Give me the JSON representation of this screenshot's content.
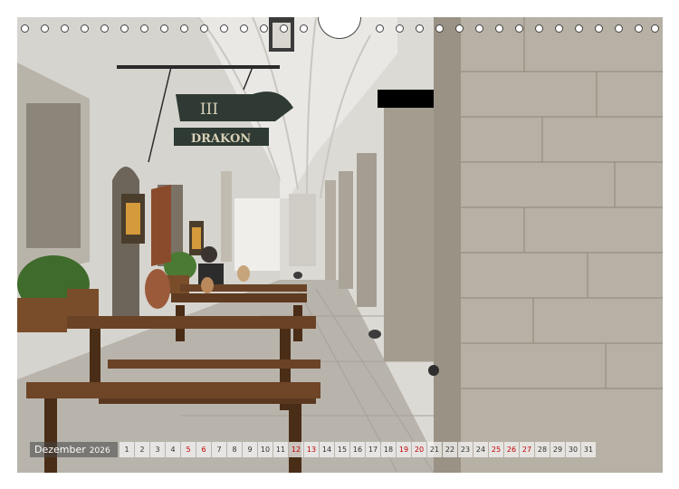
{
  "calendar": {
    "month": "Dezember",
    "year": "2026",
    "days": [
      {
        "n": "1",
        "red": false
      },
      {
        "n": "2",
        "red": false
      },
      {
        "n": "3",
        "red": false
      },
      {
        "n": "4",
        "red": false
      },
      {
        "n": "5",
        "red": true
      },
      {
        "n": "6",
        "red": true
      },
      {
        "n": "7",
        "red": false
      },
      {
        "n": "8",
        "red": false
      },
      {
        "n": "9",
        "red": false
      },
      {
        "n": "10",
        "red": false
      },
      {
        "n": "11",
        "red": false
      },
      {
        "n": "12",
        "red": true
      },
      {
        "n": "13",
        "red": true
      },
      {
        "n": "14",
        "red": false
      },
      {
        "n": "15",
        "red": false
      },
      {
        "n": "16",
        "red": false
      },
      {
        "n": "17",
        "red": false
      },
      {
        "n": "18",
        "red": false
      },
      {
        "n": "19",
        "red": true
      },
      {
        "n": "20",
        "red": true
      },
      {
        "n": "21",
        "red": false
      },
      {
        "n": "22",
        "red": false
      },
      {
        "n": "23",
        "red": false
      },
      {
        "n": "24",
        "red": false
      },
      {
        "n": "25",
        "red": true
      },
      {
        "n": "26",
        "red": true
      },
      {
        "n": "27",
        "red": true
      },
      {
        "n": "28",
        "red": false
      },
      {
        "n": "29",
        "red": false
      },
      {
        "n": "30",
        "red": false
      },
      {
        "n": "31",
        "red": false
      }
    ]
  },
  "photo": {
    "sign_number": "III",
    "sign_name": "DRAKON"
  },
  "colors": {
    "weekend_red": "#c00000"
  }
}
